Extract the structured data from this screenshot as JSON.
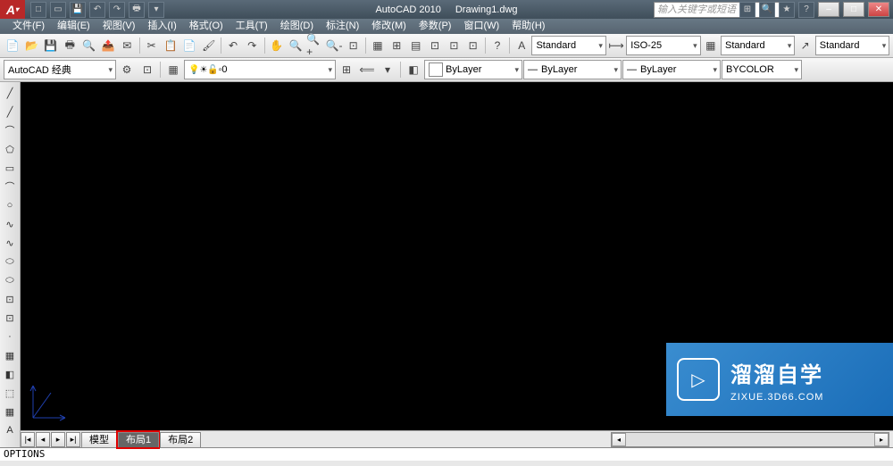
{
  "title": {
    "app": "AutoCAD 2010",
    "doc": "Drawing1.dwg"
  },
  "search": {
    "placeholder": "输入关键字或短语"
  },
  "qat": [
    "□",
    "▭",
    "🖶",
    "↶",
    "↷"
  ],
  "title_icons": [
    "⊞",
    "🔍",
    "★",
    "?",
    "–",
    "□",
    "✕"
  ],
  "menu": {
    "file": "文件(F)",
    "edit": "编辑(E)",
    "view": "视图(V)",
    "insert": "插入(I)",
    "format": "格式(O)",
    "tools": "工具(T)",
    "draw": "绘图(D)",
    "dimension": "标注(N)",
    "modify": "修改(M)",
    "parametric": "参数(P)",
    "window": "窗口(W)",
    "help": "帮助(H)"
  },
  "toolbar1_icons": [
    "□",
    "▭",
    "⎙",
    "⎘",
    "🖶",
    "🔍",
    "✂",
    "📋",
    "📄",
    "📄",
    "↶",
    "↷",
    "🔍",
    "🔍",
    "⊡",
    "✋",
    "🔍+",
    "🔍-",
    "⊞",
    "▦",
    "⊞",
    "⊡",
    "⊡",
    "⊡",
    "⊡",
    "?"
  ],
  "toolbar1_right": {
    "text_style": "Standard",
    "dim_style": "ISO-25",
    "table_style": "Standard",
    "ml_style": "Standard"
  },
  "toolbar2": {
    "workspace": "AutoCAD 经典",
    "layer0": "0",
    "bylayer1": "ByLayer",
    "bylayer2": "ByLayer",
    "bylayer3": "ByLayer",
    "bycolor": "BYCOLOR"
  },
  "left_tools": [
    "╱",
    "╱",
    "⌒",
    "⬠",
    "▭",
    "⊙",
    "⌒",
    "∿",
    "⊙",
    "⊙",
    "○",
    "⬭",
    "⊡",
    "⊡",
    "⊞",
    "⬚",
    "▦",
    "▤",
    "A"
  ],
  "tabs": {
    "nav": [
      "|◂",
      "◂",
      "▸",
      "▸|"
    ],
    "model": "模型",
    "layout1": "布局1",
    "layout2": "布局2"
  },
  "cmd": "OPTIONS",
  "watermark": {
    "title": "溜溜自学",
    "url": "ZIXUE.3D66.COM"
  }
}
